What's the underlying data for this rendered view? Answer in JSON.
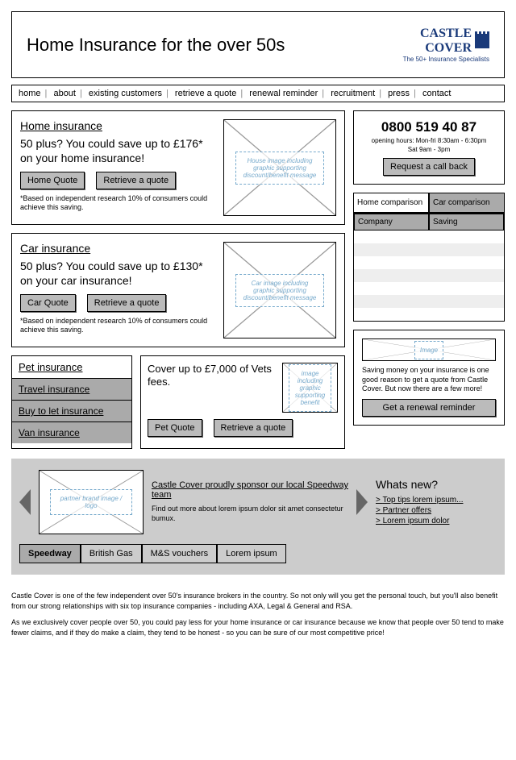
{
  "header": {
    "title": "Home Insurance for the over 50s",
    "logo_line1": "CASTLE",
    "logo_line2": "COVER",
    "logo_tag": "The 50+ Insurance Specialists"
  },
  "nav": [
    "home",
    "about",
    "existing customers",
    "retrieve a quote",
    "renewal reminder",
    "recruitment",
    "press",
    "contact"
  ],
  "home_ins": {
    "title": "Home insurance",
    "headline": "50 plus? You could save up to £176* on your home insurance!",
    "quote_btn": "Home Quote",
    "retrieve_btn": "Retrieve a quote",
    "disclaimer": "*Based on independent research 10% of consumers could achieve this saving.",
    "placeholder": "House image including graphic supporting discount/benefit message"
  },
  "car_ins": {
    "title": "Car insurance",
    "headline": "50 plus? You could save up to £130* on your car insurance!",
    "quote_btn": "Car Quote",
    "retrieve_btn": "Retrieve a quote",
    "disclaimer": "*Based on independent research 10% of consumers could achieve this saving.",
    "placeholder": "Car image including graphic supporting discount/benefit message"
  },
  "phone": {
    "number": "0800 519 40 87",
    "hours1": "opening hours: Mon-fri 8:30am - 6:30pm",
    "hours2": "Sat 9am - 3pm",
    "callback_btn": "Request a call back"
  },
  "compare": {
    "tab_home": "Home comparison",
    "tab_car": "Car comparison",
    "col1": "Company",
    "col2": "Saving"
  },
  "other_ins": {
    "title": "Pet insurance",
    "items": [
      "Travel insurance",
      "Buy to let insurance",
      "Van insurance"
    ]
  },
  "pet": {
    "headline": "Cover up to £7,000 of Vets fees.",
    "placeholder": "image including graphic supporting benefit",
    "quote_btn": "Pet Quote",
    "retrieve_btn": "Retrieve a quote"
  },
  "reminder": {
    "placeholder": "Image",
    "text": "Saving money on your insurance is one good reason to get a quote from Castle Cover. But now there are a few more!",
    "btn": "Get a renewal reminder"
  },
  "sponsor": {
    "placeholder": "partner brand image / logo",
    "title": "Castle Cover proudly sponsor our local Speedway team",
    "body": "Find out more about lorem ipsum dolor sit amet consectetur bumux."
  },
  "whatsnew": {
    "title": "Whats new?",
    "items": [
      "Top tips lorem ipsum...",
      "Partner offers",
      "Lorem ipsum dolor"
    ]
  },
  "tabs": [
    "Speedway",
    "British Gas",
    "M&S vouchers",
    "Lorem ipsum"
  ],
  "footer": {
    "p1": "Castle Cover is one of the few independent over 50's insurance brokers in the country. So not only will you get the personal touch, but you'll also benefit from our strong relationships with six top insurance companies - including AXA, Legal & General and RSA.",
    "p2": "As we exclusively cover people over 50, you could pay less for your home insurance or car insurance because we know that people over 50 tend to make fewer claims, and if they do make a claim, they tend to be honest - so you can be sure of our most competitive price!"
  }
}
